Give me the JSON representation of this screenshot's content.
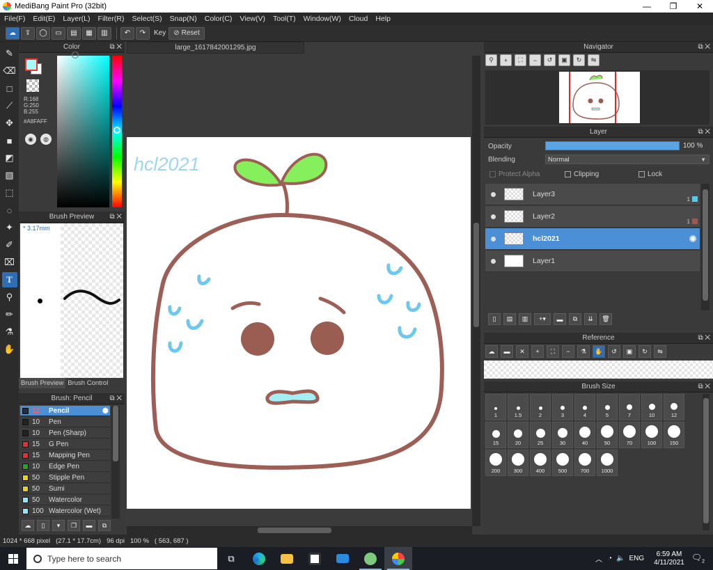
{
  "window": {
    "title": "MediBang Paint Pro (32bit)",
    "minimize": "—",
    "maximize": "❐",
    "close": "✕"
  },
  "menu": [
    "File(F)",
    "Edit(E)",
    "Layer(L)",
    "Filter(R)",
    "Select(S)",
    "Snap(N)",
    "Color(C)",
    "View(V)",
    "Tool(T)",
    "Window(W)",
    "Cloud",
    "Help"
  ],
  "toolbar": {
    "key_label": "Key",
    "reset_label": "Reset"
  },
  "color_panel": {
    "title": "Color",
    "r": "R:168",
    "g": "G:250",
    "b": "B:255",
    "hex": "#A8FAFF",
    "fg_color": "#a8faff"
  },
  "brush_preview": {
    "title": "Brush Preview",
    "size": "3.17mm",
    "tabs": [
      "Brush Preview",
      "Brush Control"
    ]
  },
  "brush_list": {
    "title": "Brush: Pencil",
    "items": [
      {
        "size": "12",
        "name": "Pencil",
        "color": "#1d3045"
      },
      {
        "size": "10",
        "name": "Pen",
        "color": "#222"
      },
      {
        "size": "10",
        "name": "Pen (Sharp)",
        "color": "#222"
      },
      {
        "size": "15",
        "name": "G Pen",
        "color": "#e03030"
      },
      {
        "size": "15",
        "name": "Mapping Pen",
        "color": "#e03030"
      },
      {
        "size": "10",
        "name": "Edge Pen",
        "color": "#2aa02a"
      },
      {
        "size": "50",
        "name": "Stipple Pen",
        "color": "#e8d020"
      },
      {
        "size": "50",
        "name": "Sumi",
        "color": "#e8d020"
      },
      {
        "size": "50",
        "name": "Watercolor",
        "color": "#8fe8ff"
      },
      {
        "size": "100",
        "name": "Watercolor (Wet)",
        "color": "#8fe8ff"
      }
    ]
  },
  "document": {
    "tab": "large_1617842001295.jpg",
    "signature": "hcl2021"
  },
  "navigator": {
    "title": "Navigator"
  },
  "layer_panel": {
    "title": "Layer",
    "opacity_label": "Opacity",
    "opacity_value": "100 %",
    "blending_label": "Blending",
    "blending_value": "Normal",
    "protect_alpha": "Protect Alpha",
    "clipping": "Clipping",
    "lock": "Lock",
    "layers": [
      {
        "name": "Layer3",
        "num": "1",
        "color": "#58c8f0"
      },
      {
        "name": "Layer2",
        "num": "1",
        "color": "#9a5a50"
      },
      {
        "name": "hcl2021",
        "num": "",
        "color": ""
      },
      {
        "name": "Layer1",
        "num": "",
        "color": ""
      }
    ]
  },
  "reference": {
    "title": "Reference"
  },
  "brush_size": {
    "title": "Brush Size",
    "sizes": [
      "1",
      "1.5",
      "2",
      "3",
      "4",
      "5",
      "7",
      "10",
      "12",
      "15",
      "20",
      "25",
      "30",
      "40",
      "50",
      "70",
      "100",
      "150",
      "200",
      "300",
      "400",
      "500",
      "700",
      "1000"
    ]
  },
  "status": {
    "dims": "1024 * 668 pixel",
    "physical": "(27.1 * 17.7cm)",
    "dpi": "96 dpi",
    "zoom": "100 %",
    "cursor": "( 563, 687 )"
  },
  "taskbar": {
    "search_placeholder": "Type here to search",
    "lang": "ENG",
    "time": "6:59 AM",
    "date": "4/11/2021",
    "notif_count": "2"
  }
}
